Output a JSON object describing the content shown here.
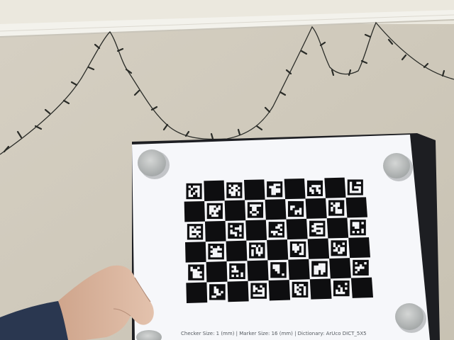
{
  "board_caption": "Checker Size: 1 (mm) | Marker Size: 16 (mm) | Dictionary: ArUco DICT_5X5",
  "board_grid": {
    "rows": 6,
    "columns": 9
  },
  "colors": {
    "wall": "#cfc9bb",
    "ceiling": "#ebe8de",
    "molding": "#f3f2ec",
    "board_paper": "#f6f7fa",
    "board_backing": "#1d1e22",
    "checker_black": "#0e0e10",
    "magnet": "#b9bcbc",
    "sleeve": "#2a3750",
    "hand": "#d9b49c",
    "string_lights": "#2a2c28"
  }
}
